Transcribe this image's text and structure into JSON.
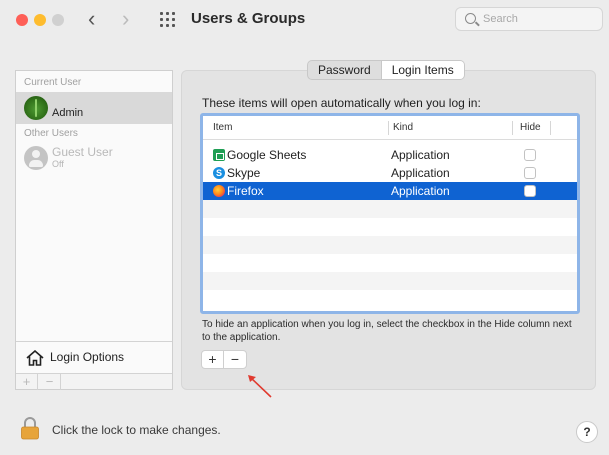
{
  "window": {
    "title": "Users & Groups"
  },
  "toolbar": {
    "back_icon": "chevron-left-icon",
    "forward_icon": "chevron-right-icon",
    "grid_icon": "grid-icon"
  },
  "search": {
    "placeholder": "Search",
    "value": ""
  },
  "users": {
    "current_label": "Current User",
    "current_user": {
      "name": "Admin"
    },
    "other_label": "Other Users",
    "others": [
      {
        "name": "Guest User",
        "status": "Off"
      }
    ],
    "login_options_label": "Login Options",
    "add_label": "+",
    "remove_label": "−"
  },
  "tabs": [
    {
      "label": "Password",
      "active": false
    },
    {
      "label": "Login Items",
      "active": true
    }
  ],
  "login_items": {
    "description": "These items will open automatically when you log in:",
    "columns": {
      "item": "Item",
      "kind": "Kind",
      "hide": "Hide"
    },
    "rows": [
      {
        "name": "Google Sheets",
        "kind": "Application",
        "hide": false,
        "icon": "google-sheets-icon",
        "selected": false
      },
      {
        "name": "Skype",
        "kind": "Application",
        "hide": false,
        "icon": "skype-icon",
        "icon_glyph": "S",
        "selected": false
      },
      {
        "name": "Firefox",
        "kind": "Application",
        "hide": false,
        "icon": "firefox-icon",
        "selected": true
      }
    ],
    "help_text": "To hide an application when you log in, select the checkbox in the Hide column next to the application.",
    "add_label": "+",
    "remove_label": "−"
  },
  "footer": {
    "lock_text": "Click the lock to make changes.",
    "help_label": "?"
  },
  "colors": {
    "selection": "#0f63d2",
    "table_border": "#8eb5e8",
    "annotation_arrow": "#e03a2f"
  }
}
